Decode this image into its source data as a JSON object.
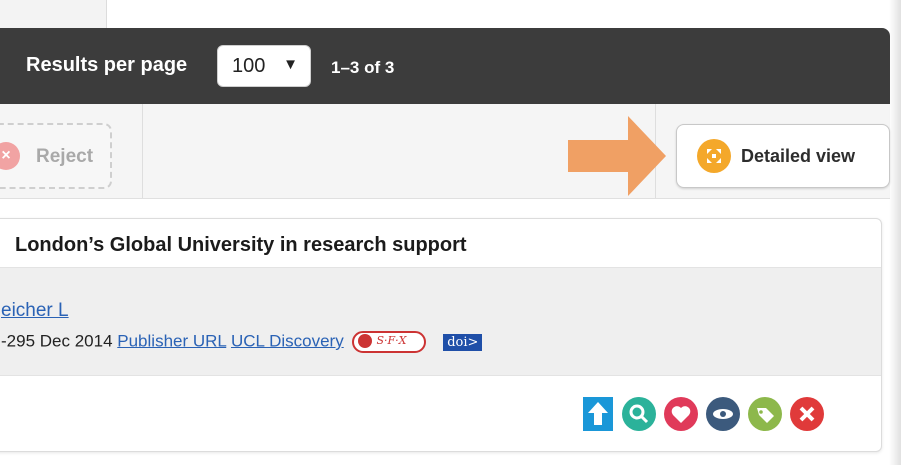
{
  "header": {
    "results_per_page_label": "Results per page",
    "results_per_page_value": "100",
    "range_text": "1–3 of 3"
  },
  "toolbar": {
    "reject_label": "Reject",
    "detailed_view_label": "Detailed view"
  },
  "record": {
    "title": "London’s Global University in research support",
    "author": "eicher L",
    "citation_prefix": "-295 Dec 2014",
    "links": [
      "Publisher URL",
      "UCL Discovery"
    ],
    "sfx_label": "S·F·X",
    "doi_label": "doi>"
  },
  "actions": [
    "upload-icon",
    "search-icon",
    "heart-icon",
    "eye-icon",
    "tag-icon",
    "close-icon"
  ],
  "colors": {
    "topbar": "#3c3c3c",
    "arrow": "#f0a064",
    "detailed_icon": "#f4a82a",
    "link": "#2a62b5"
  }
}
